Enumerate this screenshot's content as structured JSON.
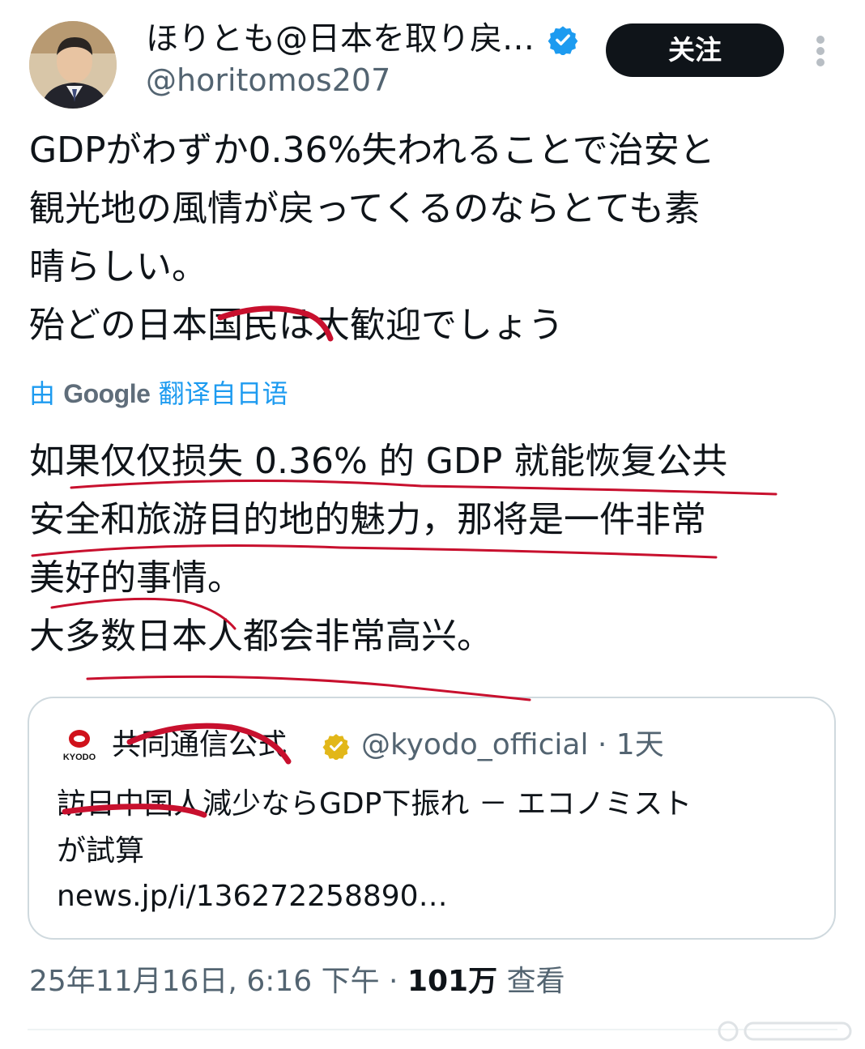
{
  "header": {
    "display_name": "ほりとも@日本を取り戻…",
    "handle": "@horitomos207",
    "follow_label": "关注"
  },
  "tweet": {
    "lines": [
      "GDPがわずか0.36%失われることで治安と",
      "観光地の風情が戻ってくるのならとても素",
      "晴らしい。",
      "殆どの日本国民は大歓迎でしょう"
    ]
  },
  "translation": {
    "prefix": "由",
    "google": "Google",
    "suffix": "翻译自日语",
    "lines": [
      "如果仅仅损失 0.36% 的 GDP 就能恢复公共",
      "安全和旅游目的地的魅力，那将是一件非常",
      "美好的事情。",
      "大多数日本人都会非常高兴。"
    ]
  },
  "quote": {
    "logo_text": "KYODO",
    "name": "共同通信公式",
    "handle": "@kyodo_official",
    "time": "· 1天",
    "lines": [
      "訪日中国人減少ならGDP下振れ － エコノミスト",
      "が試算",
      "news.jp/i/136272258890…"
    ]
  },
  "footer": {
    "timestamp": "25年11月16日, 6:16 下午 ·",
    "views_count": "101万",
    "views_label": "查看"
  },
  "colors": {
    "accent": "#1d9bf0",
    "annotation": "#c8102e",
    "text": "#0f1419",
    "muted": "#536471"
  }
}
